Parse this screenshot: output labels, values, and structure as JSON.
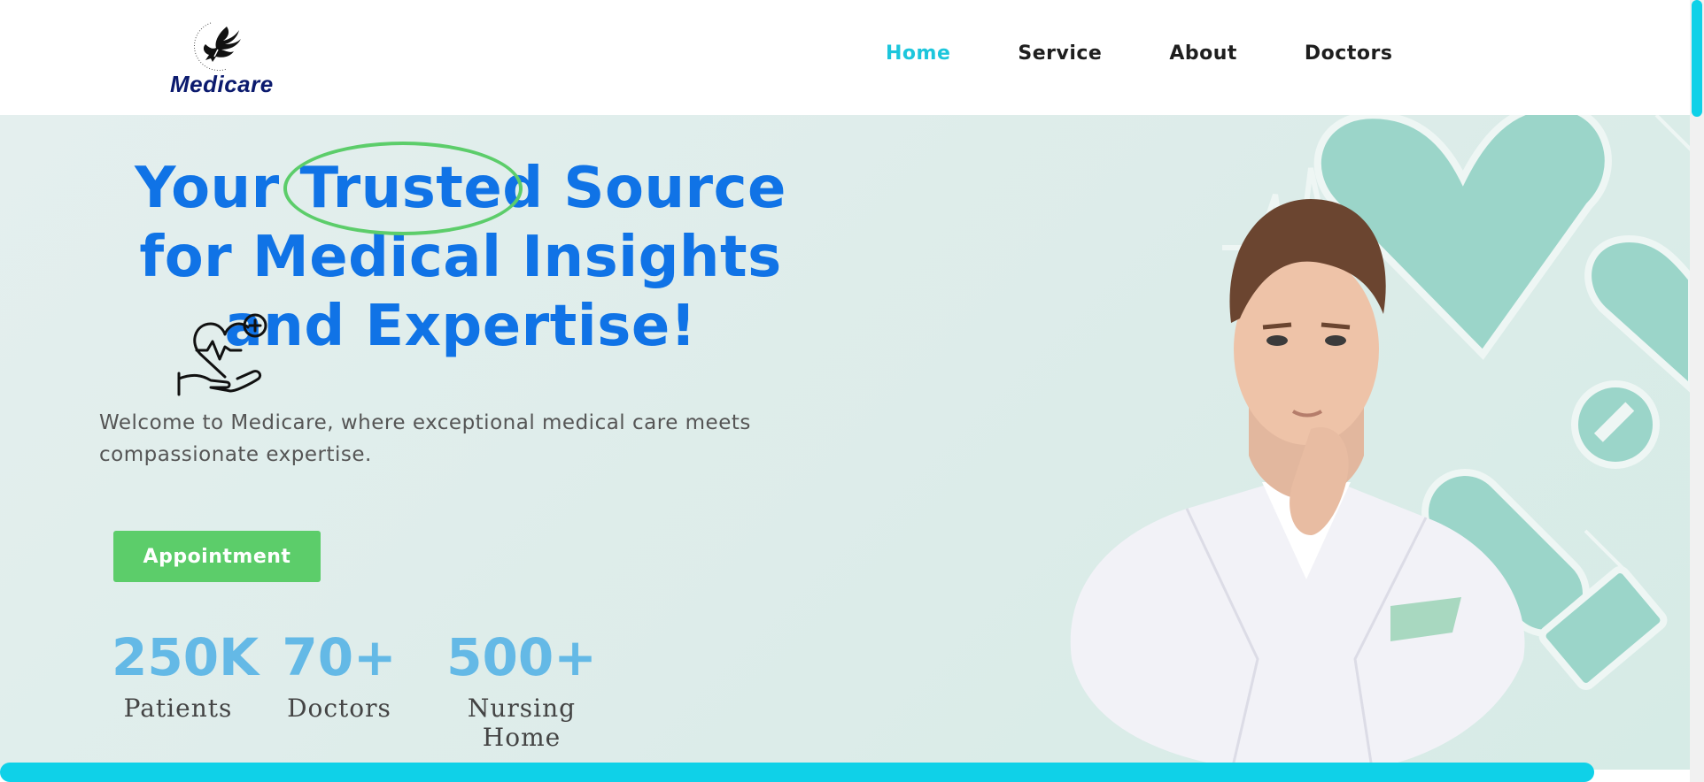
{
  "header": {
    "logo_text": "Medicare",
    "nav": [
      "Home",
      "Service",
      "About",
      "Doctors"
    ],
    "active_nav": "Home"
  },
  "hero": {
    "title_before": "Your ",
    "title_highlight": "Trusted",
    "title_after": " Source for Medical Insights and Expertise!",
    "lead": "Welcome to Medicare, where exceptional medical care meets compassionate expertise.",
    "button_label": "Appointment",
    "stats": [
      {
        "value": "250K",
        "label": "Patients"
      },
      {
        "value": "70+",
        "label": "Doctors"
      },
      {
        "value": "500+",
        "label": "Nursing Home"
      }
    ]
  },
  "colors": {
    "accent": "#1cc6dc",
    "title": "#1073e6",
    "button": "#5ccd6a",
    "stat": "#64b9e6",
    "logo": "#0b1a6e"
  },
  "icons": [
    "eagle-logo-icon",
    "heart-hand-icon"
  ]
}
